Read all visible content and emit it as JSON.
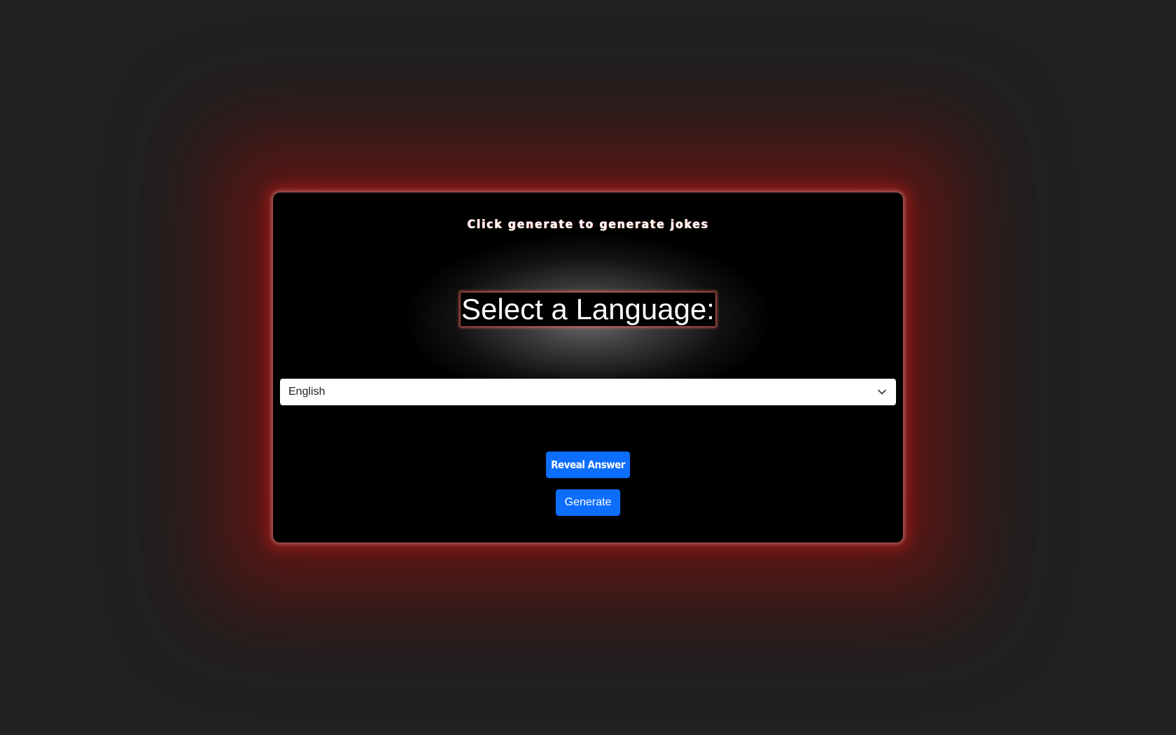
{
  "app": {
    "subtitle": "Click generate to generate jokes",
    "heading": "Select a Language:"
  },
  "language_select": {
    "selected": "English",
    "icon": "chevron-down-icon"
  },
  "buttons": {
    "reveal_label": "Reveal Answer",
    "generate_label": "Generate"
  },
  "colors": {
    "page_background": "#212121",
    "card_background": "#000000",
    "glow": "#b81e19",
    "button": "#0d6efd"
  }
}
